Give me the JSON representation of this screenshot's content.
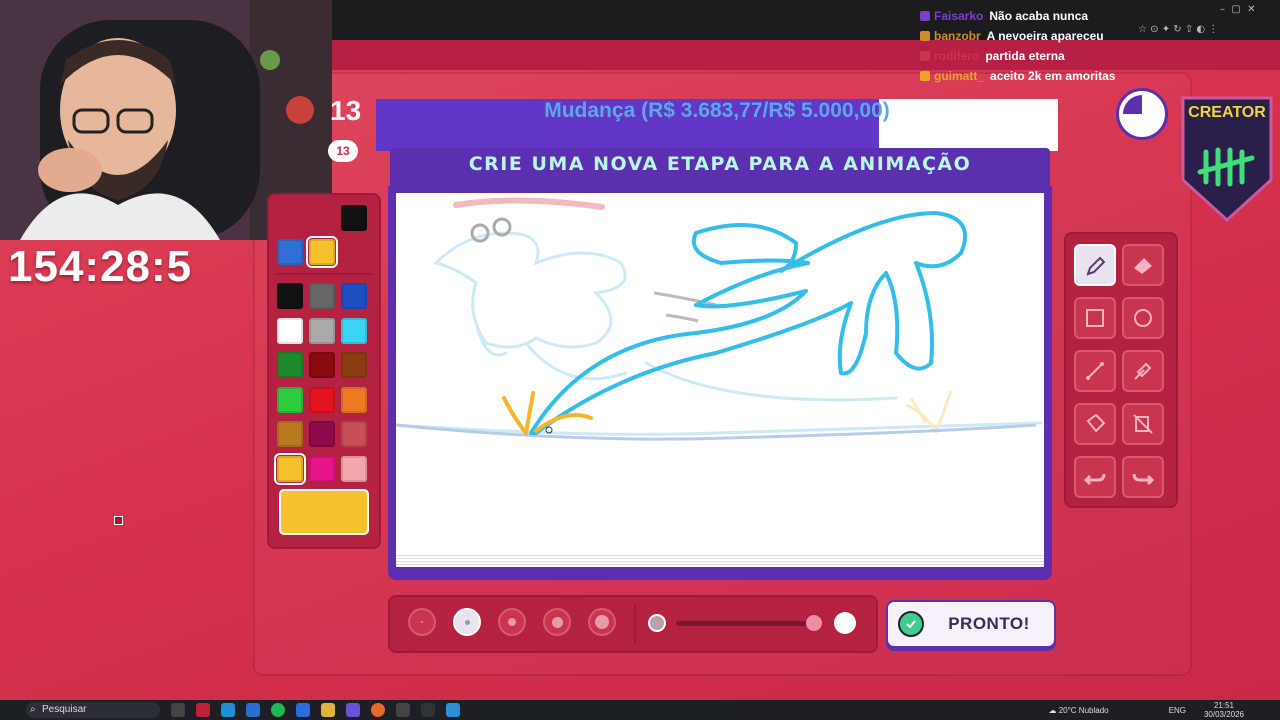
{
  "stream": {
    "timer": "154:28:5",
    "side_number": "13",
    "side_badge": "13"
  },
  "goal": {
    "text": "Mudança (R$ 3.683,77/R$ 5.000,00)",
    "progress_percent": 73.7
  },
  "game": {
    "instruction": "CRIE UMA NOVA ETAPA PARA A ANIMAÇÃO",
    "ready_label": "PRONTO!",
    "creator_label": "CREATOR"
  },
  "palette": {
    "top_row": [
      "#2f6fd6",
      "#f5c22e"
    ],
    "top_black": "#111111",
    "colors": [
      [
        "#111111",
        "#666666",
        "#1e4fc2"
      ],
      [
        "#ffffff",
        "#aaaaaa",
        "#3ad4f5"
      ],
      [
        "#1e8a2c",
        "#8a0a10",
        "#8b3c10"
      ],
      [
        "#2ecb3e",
        "#e3141e",
        "#f07a24"
      ],
      [
        "#b87a1c",
        "#8c0a4a",
        "#c84e58"
      ],
      [
        "#f5c22e",
        "#e8148a",
        "#f5a5ad"
      ]
    ],
    "selected_color": "#f5c22e"
  },
  "tools": [
    {
      "name": "pencil-tool",
      "icon": "pencil-icon",
      "active": true
    },
    {
      "name": "eraser-tool",
      "icon": "eraser-icon",
      "active": false
    },
    {
      "name": "rectangle-tool",
      "icon": "square-icon",
      "active": false
    },
    {
      "name": "ellipse-tool",
      "icon": "circle-icon",
      "active": false
    },
    {
      "name": "line-tool",
      "icon": "line-icon",
      "active": false
    },
    {
      "name": "eyedropper-tool",
      "icon": "eyedropper-icon",
      "active": false
    },
    {
      "name": "fill-tool",
      "icon": "bucket-icon",
      "active": false
    },
    {
      "name": "layer-tool",
      "icon": "layers-off-icon",
      "active": false
    },
    {
      "name": "undo-tool",
      "icon": "undo-icon",
      "active": false
    },
    {
      "name": "redo-tool",
      "icon": "redo-icon",
      "active": false
    }
  ],
  "brush_sizes": {
    "count": 5,
    "selected_index": 1
  },
  "opacity_slider": {
    "value": 1.0
  },
  "chat": [
    {
      "user": "Faisarko",
      "user_color": "#7b3fd0",
      "message": "Não acaba nunca"
    },
    {
      "user": "banzobr",
      "user_color": "#d38a2a",
      "message": "A nevoeira apareceu"
    },
    {
      "user": "rodifero",
      "user_color": "#c9354f",
      "message": "partida eterna"
    },
    {
      "user": "guimatt_",
      "user_color": "#e8a32a",
      "message": "aceito 2k em amoritas"
    }
  ],
  "taskbar": {
    "search_placeholder": "Pesquisar",
    "weather": "20°C Nublado",
    "lang": "ENG",
    "time": "21:51",
    "date": "30/03/2026"
  },
  "colors": {
    "accent_purple": "#5b2fb0",
    "background": "#d6324e",
    "drawing_cyan": "#33bde8"
  }
}
